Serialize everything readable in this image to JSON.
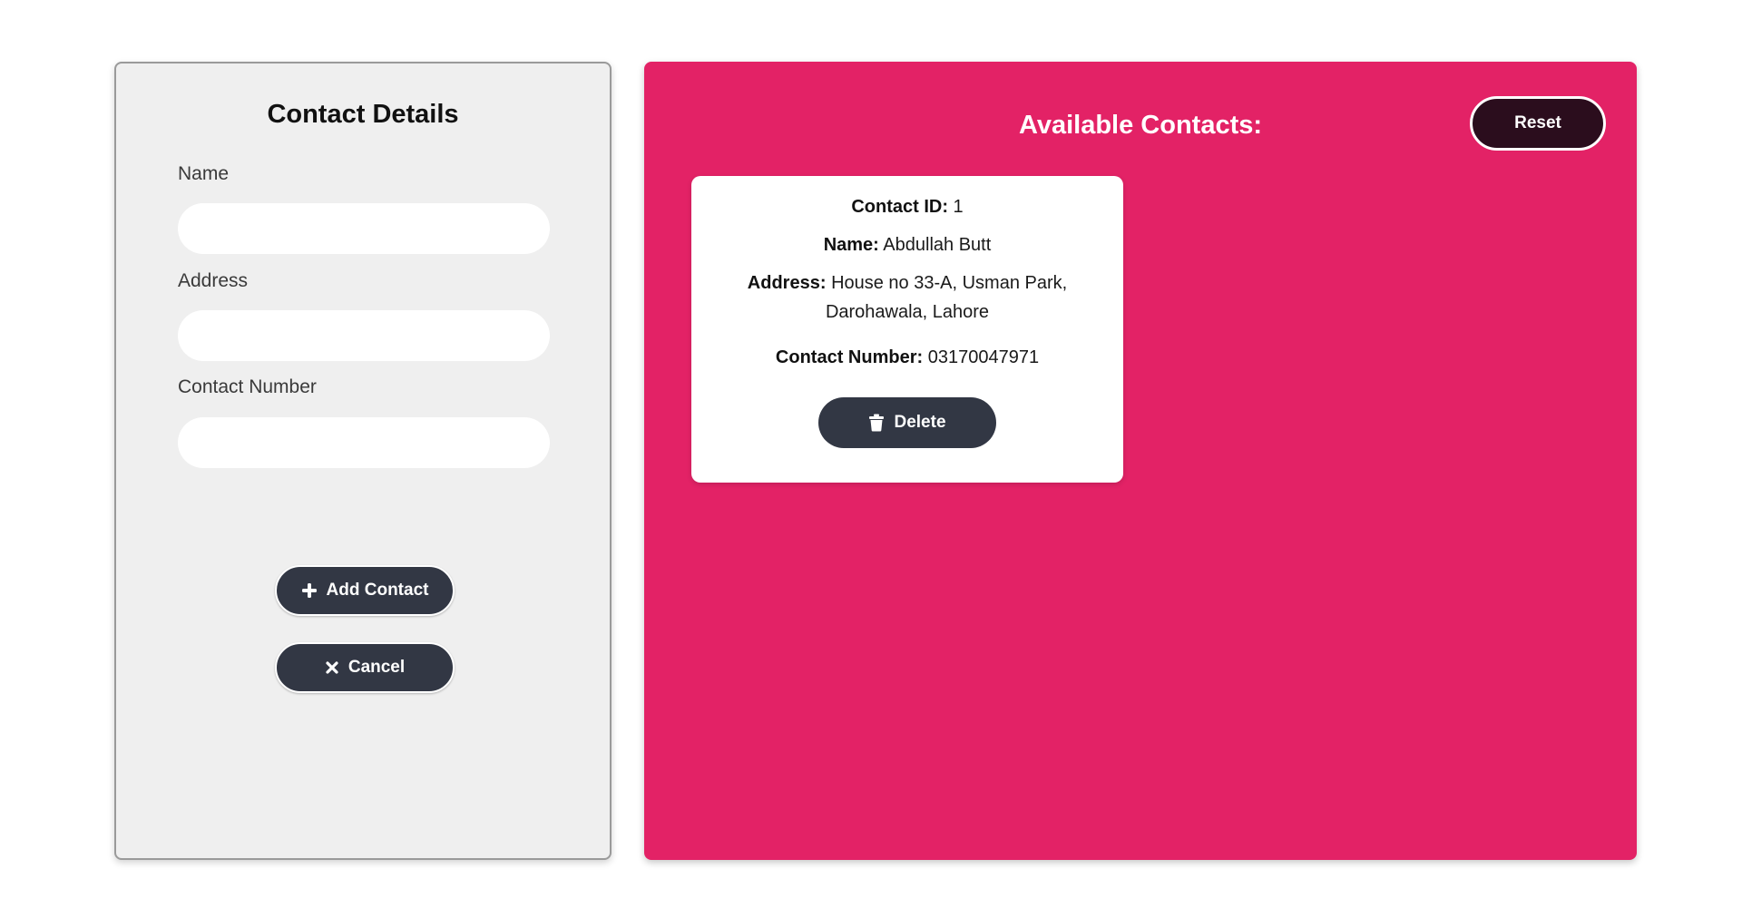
{
  "form": {
    "title": "Contact Details",
    "fields": [
      {
        "label": "Name",
        "value": "",
        "placeholder": ""
      },
      {
        "label": "Address",
        "value": "",
        "placeholder": ""
      },
      {
        "label": "Contact Number",
        "value": "",
        "placeholder": ""
      }
    ],
    "buttons": {
      "add_label": "Add Contact",
      "add_icon": "plus-icon",
      "cancel_label": "Cancel",
      "cancel_icon": "x-icon"
    }
  },
  "contacts": {
    "title": "Available Contacts:",
    "reset_label": "Reset",
    "items": [
      {
        "id_key": "Contact ID:",
        "id_value": "1",
        "name_key": "Name:",
        "name_value": "Abdullah Butt",
        "address_key": "Address:",
        "address_value": "House no 33-A, Usman Park, Darohawala, Lahore",
        "number_key": "Contact Number:",
        "number_value": "03170047971",
        "delete_label": "Delete",
        "delete_icon": "trash-icon"
      }
    ]
  },
  "colors": {
    "page_background": "#ffffff",
    "form_panel": "#efefef",
    "contacts_panel": "#e32266",
    "button_dark": "#323744",
    "reset_button": "#2b0d1d",
    "card": "#ffffff"
  }
}
